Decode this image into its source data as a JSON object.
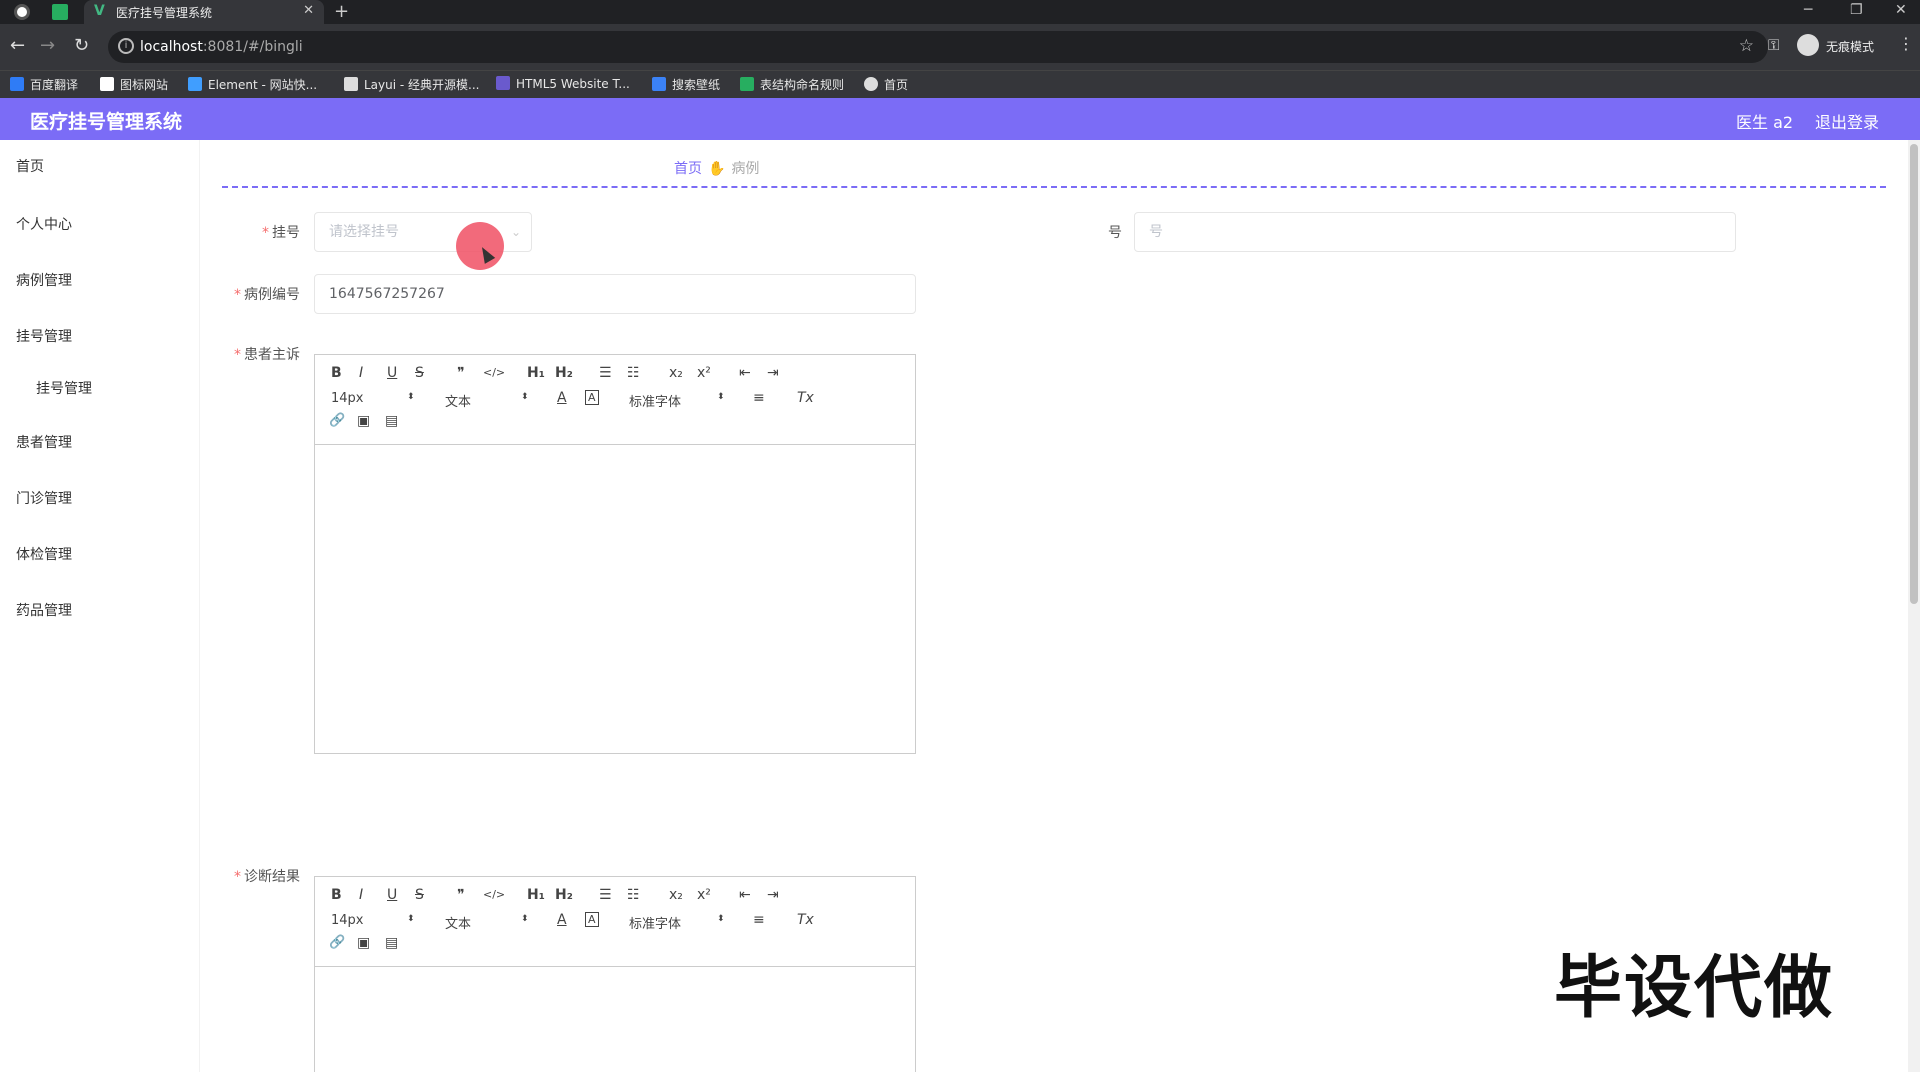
{
  "browser": {
    "tab_title": "医疗挂号管理系统",
    "tab_close": "✕",
    "new_tab": "+",
    "url_host": "localhost",
    "url_path": ":8081/#/bingli",
    "incognito_label": "无痕模式",
    "window_controls": [
      "─",
      "❐",
      "✕"
    ],
    "bookmarks": [
      {
        "label": "百度翻译",
        "color": "#2f7cf6"
      },
      {
        "label": "图标网站",
        "color": "#ffffff"
      },
      {
        "label": "Element - 网站快...",
        "color": "#409eff"
      },
      {
        "label": "Layui - 经典开源模...",
        "color": "#dddddd"
      },
      {
        "label": "HTML5 Website T...",
        "color": "#6a5acd"
      },
      {
        "label": "搜索壁纸",
        "color": "#3b82f6"
      },
      {
        "label": "表结构命名规则",
        "color": "#27ae60"
      },
      {
        "label": "首页",
        "color": "#dddddd"
      }
    ]
  },
  "header": {
    "title": "医疗挂号管理系统",
    "user": "医生 a2",
    "logout": "退出登录"
  },
  "sidebar": {
    "items": [
      "首页",
      "个人中心",
      "病例管理",
      "挂号管理",
      "挂号管理",
      "患者管理",
      "门诊管理",
      "体检管理",
      "药品管理"
    ]
  },
  "breadcrumb": {
    "home": "首页",
    "current": "病例"
  },
  "form": {
    "guahao_label": "挂号",
    "guahao_placeholder": "请选择挂号",
    "hao_label": "号",
    "hao_placeholder": "号",
    "bingli_label": "病例编号",
    "bingli_value": "1647567257267",
    "zhusu_label": "患者主诉",
    "zhenduan_label": "诊断结果"
  },
  "editor_toolbar": {
    "bold": "B",
    "italic": "I",
    "underline": "U",
    "strike": "S",
    "quote": "❞",
    "code": "</>",
    "h1": "H₁",
    "h2": "H₂",
    "ordered_list": "☰",
    "bullet_list": "☷",
    "subscript": "x₂",
    "superscript": "x²",
    "outdent": "⇤",
    "indent": "⇥",
    "size": "14px",
    "header_style": "文本",
    "color": "A",
    "background": "A",
    "font": "标准字体",
    "align": "≡",
    "clean": "Tx",
    "link": "🔗",
    "image": "▣",
    "video": "▤"
  },
  "watermark": "毕设代做"
}
